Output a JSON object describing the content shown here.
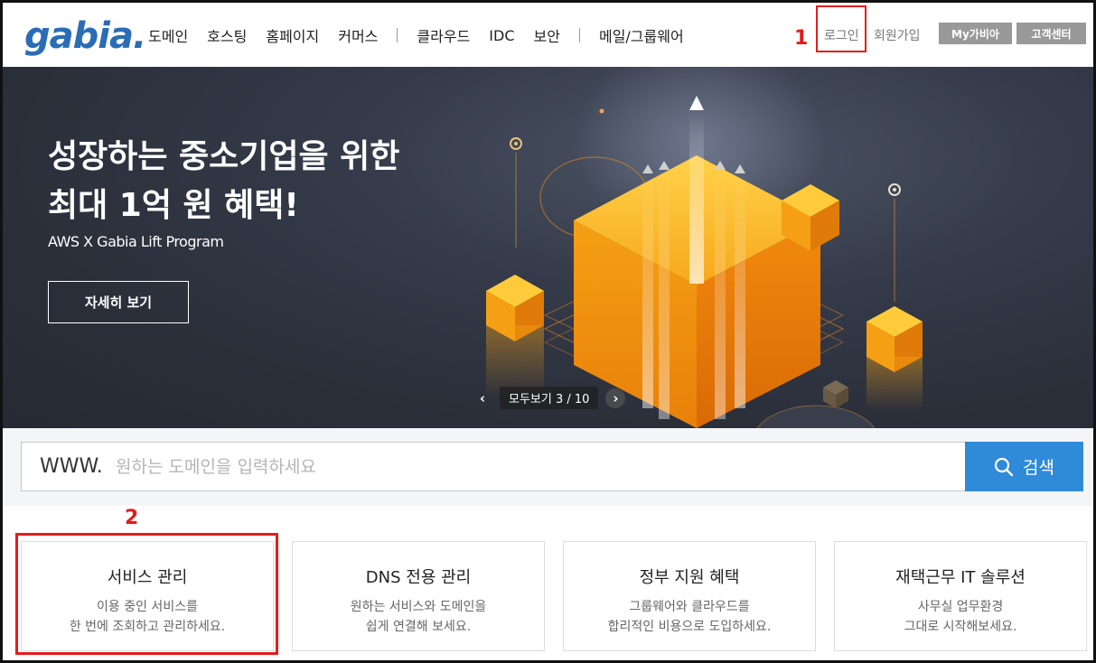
{
  "header": {
    "logo": "gabia.",
    "nav": [
      "도메인",
      "호스팅",
      "홈페이지",
      "커머스",
      "클라우드",
      "IDC",
      "보안",
      "메일/그룹웨어"
    ],
    "login": "로그인",
    "signup": "회원가입",
    "my_gabia": "My가비아",
    "customer_center": "고객센터"
  },
  "annotations": {
    "label_1": "1",
    "label_2": "2"
  },
  "banner": {
    "title_line1": "성장하는 중소기업을 위한",
    "title_line2": "최대 1억 원 혜택!",
    "subtitle": "AWS X Gabia Lift Program",
    "button": "자세히 보기",
    "pager_prev": "‹",
    "pager_text": "모두보기  3 / 10",
    "pager_next": "›"
  },
  "search": {
    "prefix": "WWW.",
    "placeholder": "원하는 도메인을 입력하세요",
    "value": "",
    "button": "검색"
  },
  "cards": [
    {
      "title": "서비스 관리",
      "desc1": "이용 중인 서비스를",
      "desc2": "한 번에 조회하고 관리하세요."
    },
    {
      "title": "DNS 전용 관리",
      "desc1": "원하는 서비스와 도메인을",
      "desc2": "쉽게 연결해 보세요."
    },
    {
      "title": "정부 지원 혜택",
      "desc1": "그룹웨어와 클라우드를",
      "desc2": "합리적인 비용으로 도입하세요."
    },
    {
      "title": "재택근무 IT 솔루션",
      "desc1": "사무실 업무환경",
      "desc2": "그대로 시작해보세요."
    }
  ],
  "colors": {
    "accent": "#2f8ad8",
    "highlight": "#e51c1c",
    "banner_bg": "#2b2f3a",
    "cube": "#f5a014"
  }
}
